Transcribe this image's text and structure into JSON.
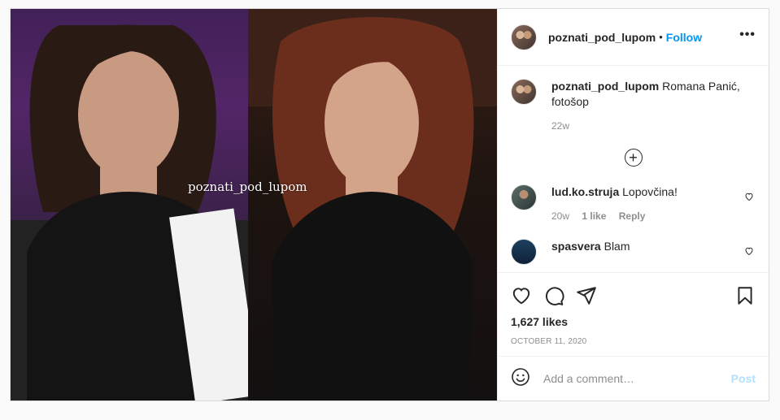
{
  "post": {
    "image": {
      "watermark": "poznati_pod_lupom",
      "left_bg_color": "#5b2a6e",
      "right_bg_color": "#1e1410"
    },
    "header": {
      "username": "poznati_pod_lupom",
      "separator": "•",
      "follow_label": "Follow",
      "more_icon": "more-horizontal-icon",
      "more_label": "•••"
    },
    "caption": {
      "username": "poznati_pod_lupom",
      "text": "Romana Panić, fotošop",
      "time": "22w"
    },
    "load_more_icon": "plus-circle-icon",
    "load_more_label": "+",
    "comments": [
      {
        "username": "lud.ko.struja",
        "text": "Lopovčina!",
        "time": "20w",
        "likes": "1 like",
        "reply": "Reply"
      },
      {
        "username": "spasvera",
        "text": "Blam"
      }
    ],
    "actions": {
      "like_icon": "heart-icon",
      "comment_icon": "comment-bubble-icon",
      "share_icon": "paper-plane-icon",
      "save_icon": "bookmark-icon",
      "likes_count": "1,627 likes",
      "date": "OCTOBER 11, 2020"
    },
    "add_comment": {
      "emoji_icon": "emoji-smile-icon",
      "placeholder": "Add a comment…",
      "post_label": "Post",
      "post_color": "#b2dffc"
    },
    "colors": {
      "accent": "#0095f6",
      "text": "#262626",
      "muted": "#8e8e8e",
      "border": "#dbdbdb"
    }
  }
}
